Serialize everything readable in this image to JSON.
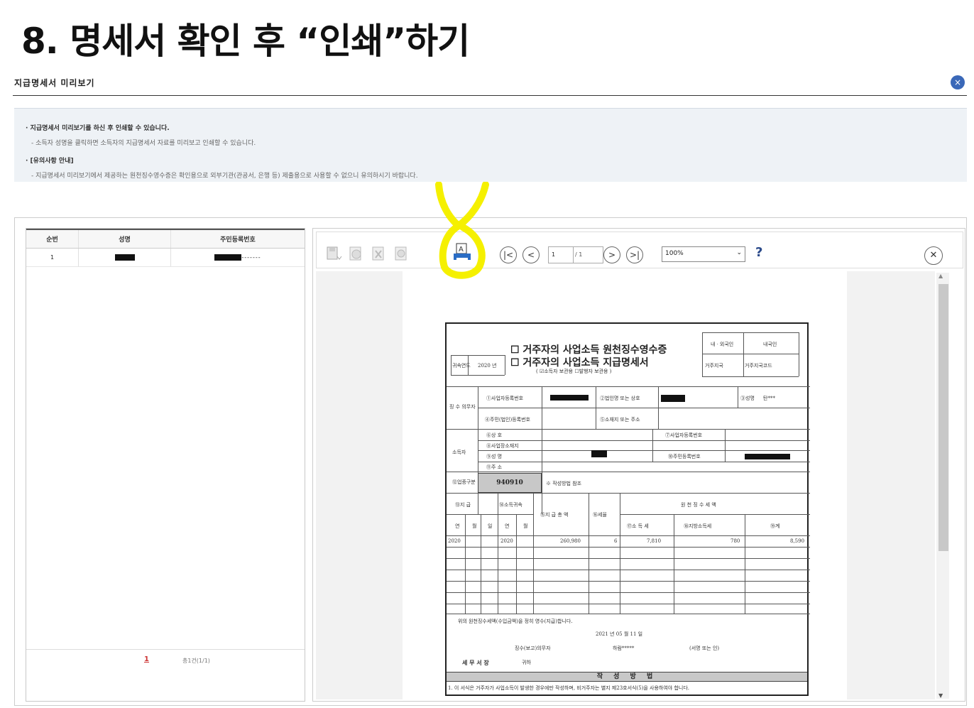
{
  "page": {
    "title": "8.  명세서 확인 후 “인쇄”하기"
  },
  "modal": {
    "title": "지급명세서 미리보기",
    "close_glyph": "×"
  },
  "notice": {
    "line1": "· 지급명세서 미리보기를 하신 후 인쇄할 수 있습니다.",
    "line2": "- 소득자 성명을 클릭하면 소득자의 지급명세서 자료를 미리보고 인쇄할 수 있습니다.",
    "line3": "· [유의사항 안내]",
    "line4": "- 지급명세서 미리보기에서 제공하는 원천징수영수증은 확인용으로 외부기관(관공서, 은행 등) 제출용으로 사용할 수 없으니 유의하시기 바랍니다."
  },
  "list": {
    "headers": [
      "순번",
      "성명",
      "주민등록번호"
    ],
    "rows": [
      {
        "no": "1",
        "name": "",
        "id_suffix": "-------"
      }
    ],
    "pager": {
      "current": "1",
      "info": "총1건(1/1)"
    }
  },
  "viewer": {
    "page_current": "1",
    "page_total": "/ 1",
    "zoom": "100%",
    "help": "?",
    "close_glyph": "✕",
    "nav": {
      "first": "|<",
      "prev": "<",
      "next": ">",
      "last": ">|"
    }
  },
  "form": {
    "title1": "☐ 거주자의 사업소득 원천징수영수증",
    "title2": "☐ 거주자의 사업소득 지급명세서",
    "subtitle": "( ☑소득자 보관용   ☐발행자 보관용 )",
    "year_label": "귀속연도",
    "year": "2020 년",
    "resident_in": "내ㆍ외국인",
    "resident_val": "내국인",
    "residence_label": "거주지국",
    "residence_code": "거주지국코드",
    "payer_label": "징 수 의무자",
    "f1": "①사업자등록번호",
    "f2": "②법인명 또는 상호",
    "f3": "③성명",
    "f3_val": "탄***",
    "f4": "④주민(법인)등록번호",
    "f5": "⑤소재지 또는 주소",
    "earner_label": "소득자",
    "f6": "⑥상 호",
    "f7": "⑦사업자등록번호",
    "f8": "⑧사업장소재지",
    "f9": "⑨성 명",
    "f10": "⑩주민등록번호",
    "f11": "⑪주 소",
    "code_label": "⑫업종구분",
    "code": "940910",
    "code_note": "※ 작성방법 참조",
    "col_pay": "⑬지 급",
    "col_belong": "⑭소득귀속",
    "col_total": "⑮지 급 총 액",
    "col_rate": "⑯세율",
    "col_withheld": "원 천 징 수 세 액",
    "col_income_tax": "⑰소 득 세",
    "col_local_tax": "⑱지방소득세",
    "col_sum": "⑲계",
    "h_y": "연",
    "h_m": "월",
    "h_d": "일",
    "h_y2": "연",
    "h_m2": "월",
    "row": {
      "pay_year": "2020",
      "belong_year": "2020",
      "total": "260,980",
      "rate": "6",
      "income_tax": "7,810",
      "local_tax": "780",
      "sum": "8,590"
    },
    "confirm": "위의 원천징수세액(수입금액)을 정히 영수(지급)합니다.",
    "date": "2021 년 05 월 11 일",
    "payer_role": "징수(보고)의무자",
    "payer_name": "하람*****",
    "sign": "(서명 또는 인)",
    "tax_office": "세 무 서 장",
    "tax_office_suffix": "귀하",
    "method_title": "작 성 방 법",
    "method_line": "1. 이 서식은 거주자가 사업소득이 발생한 경우에만 작성하며, 비거주자는 별지 제23호서식(5)을 사용하여야 합니다."
  },
  "colors": {
    "accent": "#3a68b8",
    "highlight": "#f5f000",
    "page_link": "#cc3333"
  }
}
